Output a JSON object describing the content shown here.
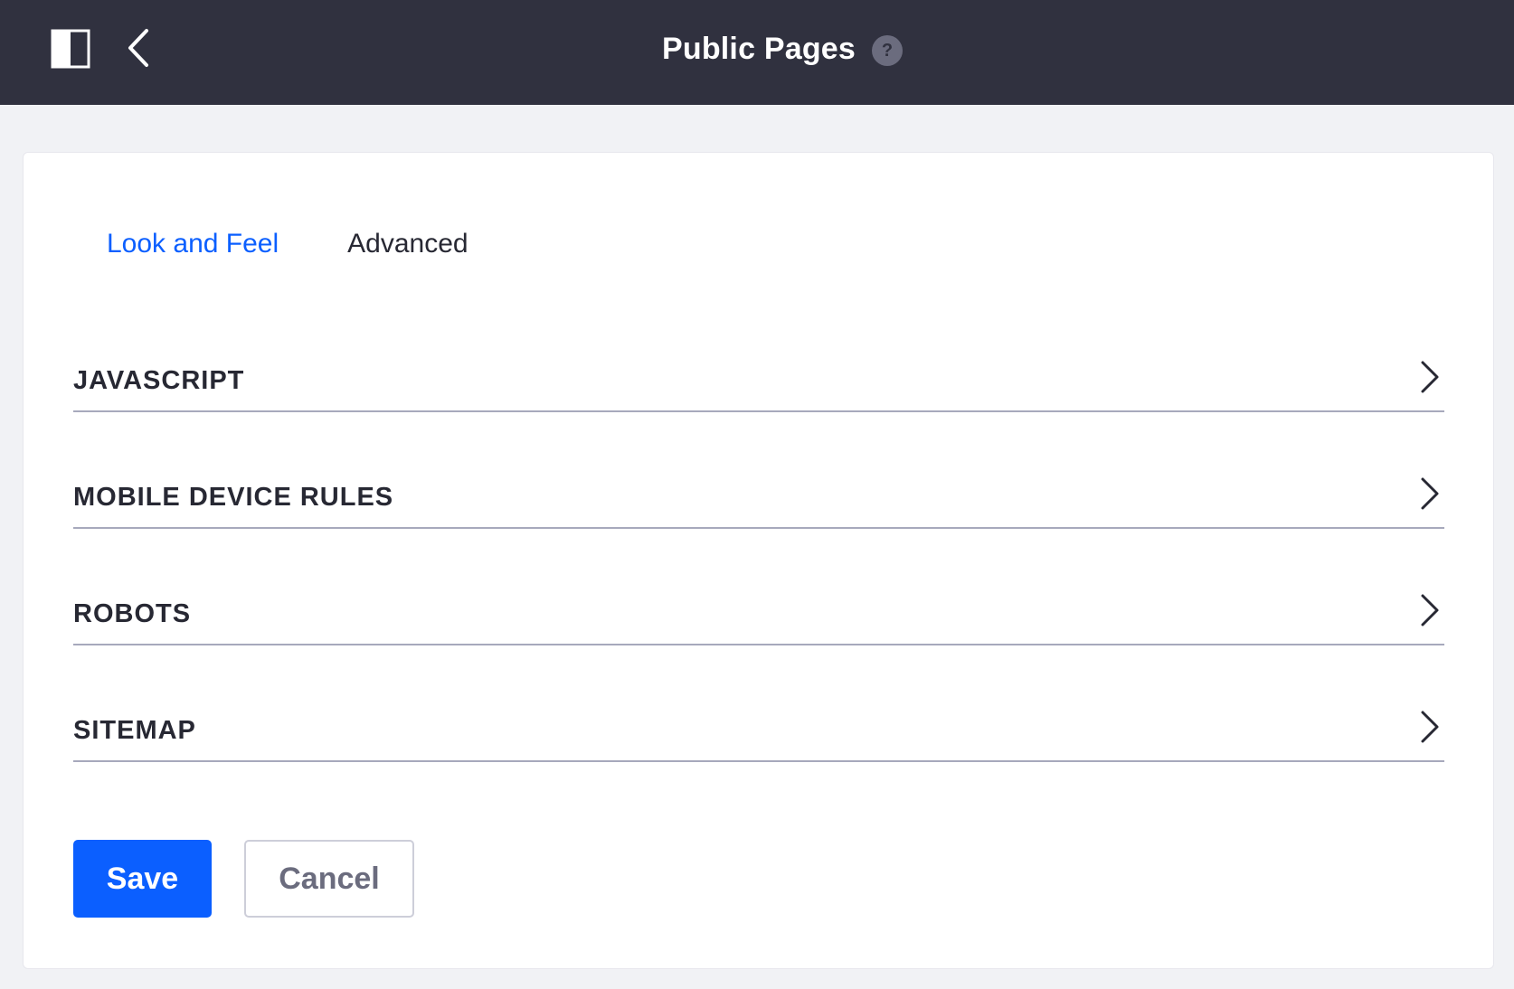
{
  "header": {
    "title": "Public Pages",
    "help_glyph": "?",
    "icons": {
      "panel_toggle": "sidebar-toggle-icon",
      "back": "chevron-left-icon",
      "help": "question-circle-icon"
    }
  },
  "tabs": [
    {
      "label": "Look and Feel",
      "active": true
    },
    {
      "label": "Advanced",
      "active": false
    }
  ],
  "sections": [
    {
      "label": "JAVASCRIPT"
    },
    {
      "label": "MOBILE DEVICE RULES"
    },
    {
      "label": "ROBOTS"
    },
    {
      "label": "SITEMAP"
    }
  ],
  "actions": {
    "save_label": "Save",
    "cancel_label": "Cancel"
  },
  "colors": {
    "header_bg": "#30313f",
    "page_bg": "#f1f2f5",
    "accent": "#0b5fff",
    "divider": "#a7a9bc"
  }
}
